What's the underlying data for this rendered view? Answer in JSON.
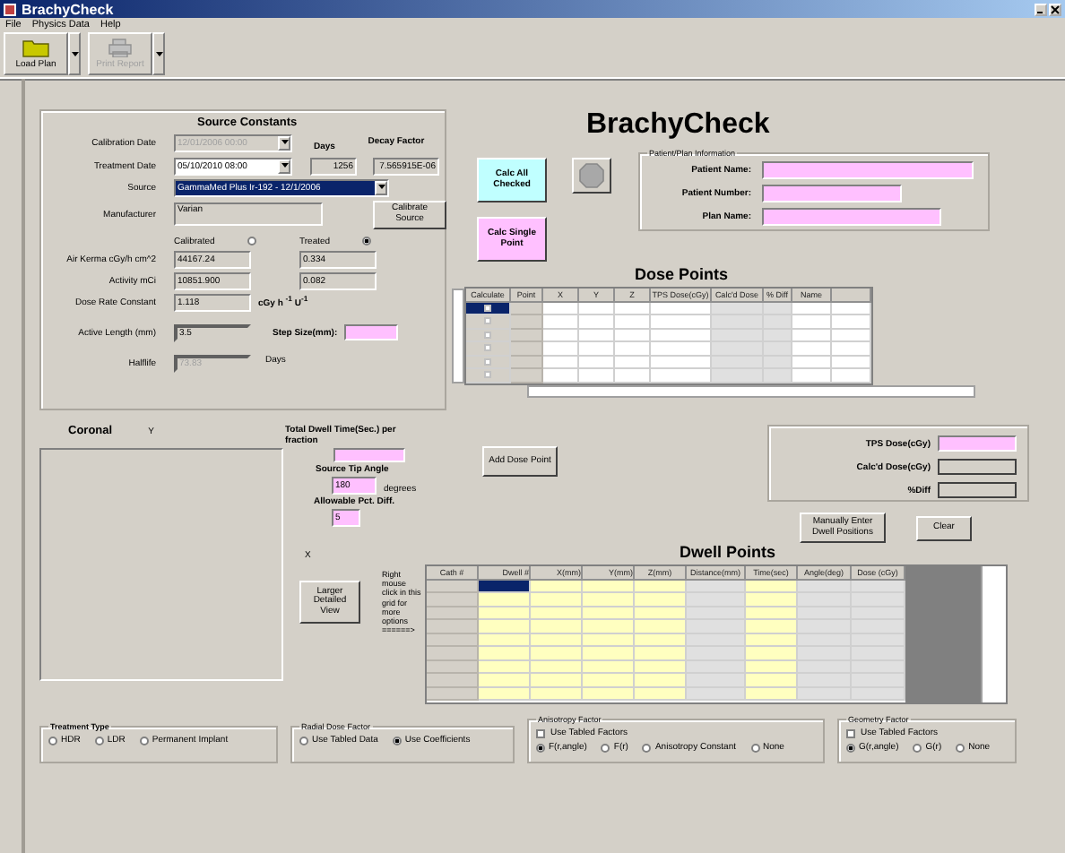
{
  "window": {
    "title": "BrachyCheck"
  },
  "menu": [
    "File",
    "Physics Data",
    "Help"
  ],
  "toolbar": [
    {
      "label": "Load Plan",
      "disabled": false
    },
    {
      "label": "Print Report",
      "disabled": true
    }
  ],
  "source_constants": {
    "title": "Source Constants",
    "calibration_date": {
      "label": "Calibration Date",
      "value": "12/01/2006 00:00",
      "disabled": true
    },
    "treatment_date": {
      "label": "Treatment Date",
      "value": "05/10/2010  08:00",
      "disabled": false
    },
    "days": {
      "label": "Days",
      "value": "1256"
    },
    "decay_factor": {
      "label": "Decay Factor",
      "value": "7.565915E-06"
    },
    "source": {
      "label": "Source",
      "value": "GammaMed Plus Ir-192 - 12/1/2006"
    },
    "manufacturer": {
      "label": "Manufacturer",
      "value": "Varian"
    },
    "calibrate_button": "Calibrate Source",
    "modes": [
      {
        "label": "Calibrated",
        "selected": false
      },
      {
        "label": "Treated",
        "selected": true
      }
    ],
    "rows": [
      {
        "label": "Air Kerma    cGy/h cm^2",
        "calibrated": "44167.24",
        "treated": "0.334"
      },
      {
        "label": "Activity mCi",
        "calibrated": "10851.900",
        "treated": "0.082"
      }
    ],
    "dose_rate_constant": {
      "label": "Dose Rate Constant",
      "value": "1.118",
      "unit": "cGy h $^{-1}$  U$^{-1}$"
    },
    "active_length": {
      "label": "Active Length (mm)",
      "value": "3.5"
    },
    "step_size": {
      "label": "Step Size(mm):"
    },
    "halflife": {
      "label": "Halflife",
      "value": "73.83",
      "unit": "Days",
      "disabled": true
    }
  },
  "header": {
    "title": "BrachyCheck",
    "calc_all": "Calc All Checked",
    "calc_single": "Calc Single Point"
  },
  "patient": {
    "title": "Patient/Plan Information",
    "fields": [
      "Patient Name:",
      "Patient Number:",
      "Plan Name:"
    ]
  },
  "dose_points": {
    "title": "Dose Points",
    "columns": [
      {
        "label": "Calculate",
        "kind": "check"
      },
      {
        "label": "Point",
        "kind": "header"
      },
      {
        "label": "X",
        "kind": "editable"
      },
      {
        "label": "Y",
        "kind": "editable"
      },
      {
        "label": "Z",
        "kind": "editable"
      },
      {
        "label": "TPS Dose(cGy)",
        "kind": "editable"
      },
      {
        "label": "Calc'd Dose",
        "kind": "computed"
      },
      {
        "label": "% Diff",
        "kind": "computed"
      },
      {
        "label": "Name",
        "kind": "editable"
      }
    ],
    "rows": [
      {
        "checked": false,
        "selected": true
      },
      {
        "checked": false,
        "selected": false
      },
      {
        "checked": false,
        "selected": false
      },
      {
        "checked": false,
        "selected": false
      },
      {
        "checked": false,
        "selected": false
      },
      {
        "checked": false,
        "selected": false
      }
    ]
  },
  "coronal": {
    "title": "Coronal",
    "y_axis": "Y",
    "x_axis": "X"
  },
  "dwell_settings": {
    "total_time": {
      "label": "Total Dwell Time(Sec.) per fraction"
    },
    "tip_angle": {
      "label": "Source Tip Angle",
      "value": "180",
      "unit": "degrees"
    },
    "allowable": {
      "label": "Allowable Pct. Diff.",
      "value": "5"
    }
  },
  "add_dose_point": "Add Dose Point",
  "results": [
    {
      "label": "TPS Dose(cGy)",
      "editable": true
    },
    {
      "label": "Calc'd Dose(cGy)",
      "editable": false
    },
    {
      "label": "%Diff",
      "editable": false
    }
  ],
  "manual_button": "Manually Enter Dwell Positions",
  "clear_button": "Clear",
  "larger_view_button": "Larger Detailed View",
  "grid_hint": "Right mouse click in this grid for more options ======>",
  "dwell_points": {
    "title": "Dwell Points",
    "columns": [
      {
        "label": "Cath #",
        "kind": "header"
      },
      {
        "label": "Dwell #",
        "kind": "editable"
      },
      {
        "label": "X(mm)",
        "kind": "editable"
      },
      {
        "label": "Y(mm)",
        "kind": "editable"
      },
      {
        "label": "Z(mm)",
        "kind": "editable"
      },
      {
        "label": "Distance(mm)",
        "kind": "computed"
      },
      {
        "label": "Time(sec)",
        "kind": "editable"
      },
      {
        "label": "Angle(deg)",
        "kind": "computed"
      },
      {
        "label": "Dose (cGy)",
        "kind": "computed"
      }
    ],
    "rows": [
      {
        "selected": true
      },
      {
        "selected": false
      },
      {
        "selected": false
      },
      {
        "selected": false
      },
      {
        "selected": false
      },
      {
        "selected": false
      },
      {
        "selected": false
      },
      {
        "selected": false
      },
      {
        "selected": false
      }
    ]
  },
  "option_groups": [
    {
      "title": "Treatment Type",
      "bold": true,
      "options": [
        {
          "label": "HDR",
          "selected": false
        },
        {
          "label": "LDR",
          "selected": false
        },
        {
          "label": "Permanent Implant",
          "selected": false
        }
      ]
    },
    {
      "title": "Radial Dose Factor",
      "bold": false,
      "options": [
        {
          "label": "Use Tabled Data",
          "selected": false
        },
        {
          "label": "Use Coefficients",
          "selected": true
        }
      ]
    },
    {
      "title": "Anisotropy Factor",
      "bold": false,
      "checkbox": {
        "label": "Use Tabled Factors",
        "checked": false
      },
      "options": [
        {
          "label": "F(r,angle)",
          "selected": true
        },
        {
          "label": "F(r)",
          "selected": false
        },
        {
          "label": "Anisotropy Constant",
          "selected": false
        },
        {
          "label": "None",
          "selected": false
        }
      ]
    },
    {
      "title": "Geometry Factor",
      "bold": false,
      "checkbox": {
        "label": "Use Tabled Factors",
        "checked": false
      },
      "options": [
        {
          "label": "G(r,angle)",
          "selected": true
        },
        {
          "label": "G(r)",
          "selected": false
        },
        {
          "label": "None",
          "selected": false
        }
      ]
    }
  ]
}
